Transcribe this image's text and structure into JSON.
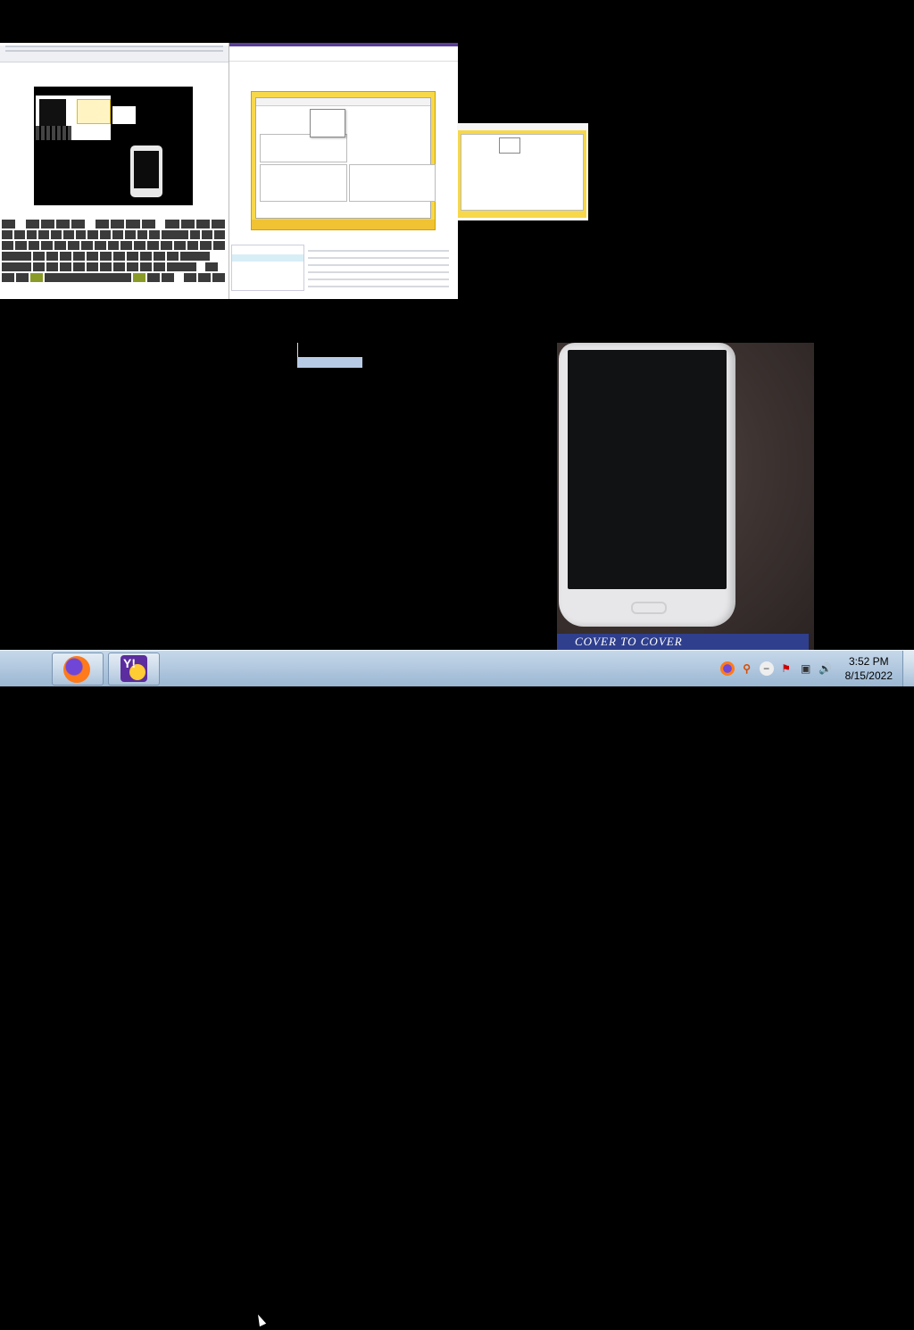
{
  "desktop": {
    "photo_caption": "COVER TO COVER"
  },
  "taskbar": {
    "pinned": [
      {
        "name": "firefox-icon"
      },
      {
        "name": "yahoo-messenger-icon",
        "letter": "Y!"
      }
    ],
    "tray_icons": [
      "firefox-icon",
      "search-icon",
      "minus-icon",
      "flag-icon",
      "network-icon",
      "volume-icon"
    ],
    "clock": {
      "time": "3:52 PM",
      "date": "8/15/2022"
    }
  },
  "colors": {
    "taskbar": "#b4cbe1",
    "accent_yellow": "#f7d84a",
    "cover_blue": "#2f3f8e",
    "selection": "#b8cbe6"
  }
}
